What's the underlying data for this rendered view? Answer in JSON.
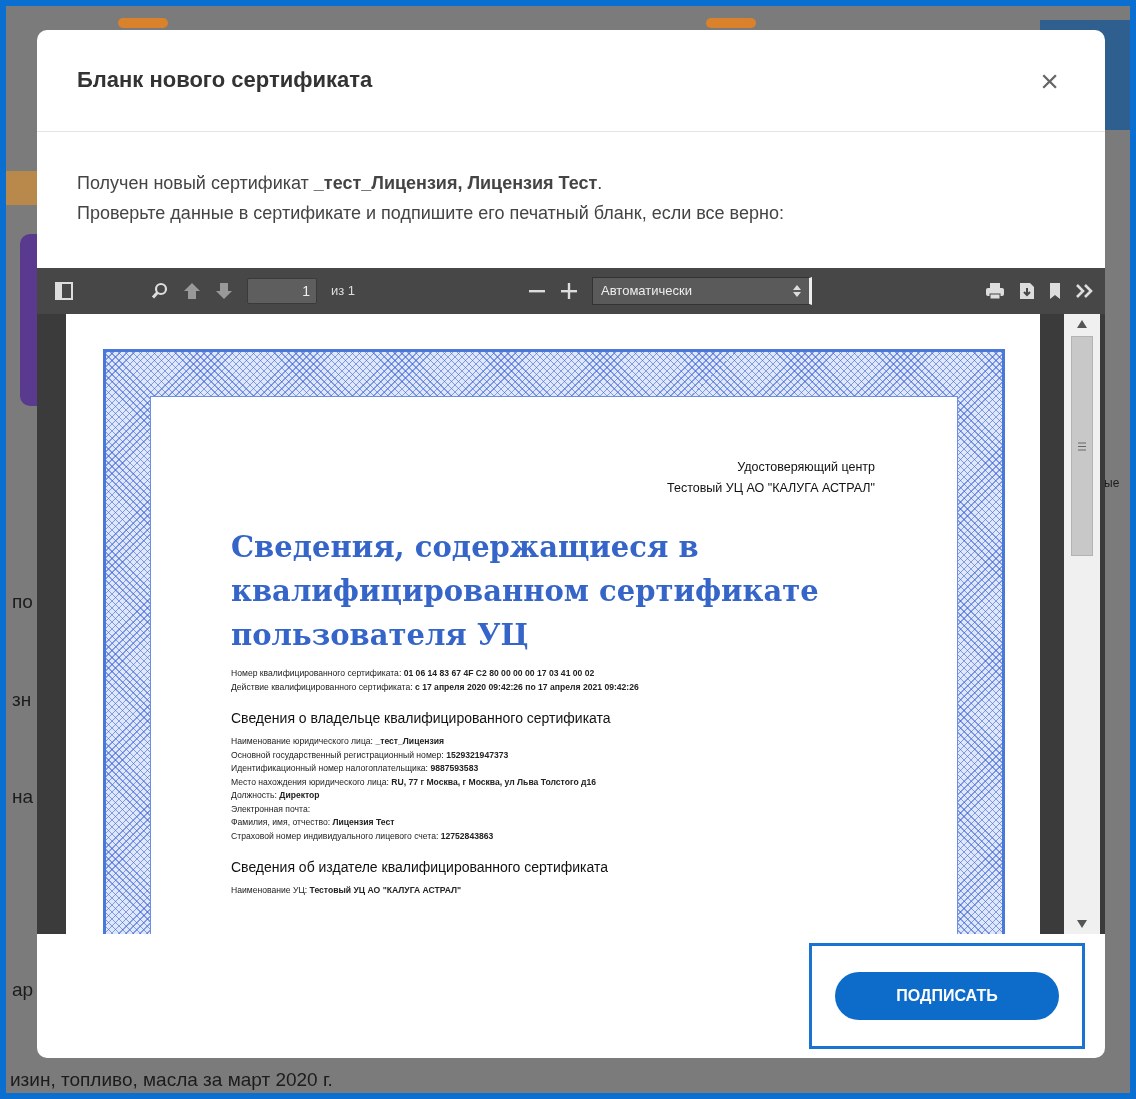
{
  "background": {
    "left_fragments": [
      "по",
      "зн",
      "на",
      "ар"
    ],
    "right_fragment": "ые",
    "bottom_text": "изин, топливо, масла за март 2020 г."
  },
  "dialog": {
    "title": "Бланк нового сертификата",
    "close": "×",
    "message": [
      "Получен новый сертификат **_тест_Лицензия, Лицензия Тест**.",
      "Проверьте данные в сертификате и подпишите его печатный бланк, если все верно:"
    ],
    "viewer": {
      "page_number": "1",
      "page_count": "из 1",
      "zoom": "Автоматически",
      "document": {
        "issuer": [
          "Удостоверяющий центр",
          "Тестовый УЦ АО \"КАЛУГА АСТРАЛ\""
        ],
        "title": "Сведения, содержащиеся в квалифицированном сертификате пользователя УЦ",
        "lines": [
          "Номер квалифицированного сертификата: **01 06 14 83 67 4F C2 80 00 00 00 17 03 41 00 02**",
          "Действие квалифицированного сертификата: **с 17 апреля 2020 09:42:26 по 17 апреля 2021 09:42:26**"
        ],
        "sections": [
          {
            "heading": "Сведения о владельце квалифицированного сертификата",
            "lines": [
              "Наименование юридического лица: **_тест_Лицензия**",
              "Основной государственный регистрационный номер: **1529321947373**",
              "Идентификационный номер налогоплательщика: **9887593583**",
              "Место нахождения юридического лица: **RU, 77 г Москва, г Москва, ул Льва Толстого д16**",
              "Должность: **Директор**",
              "Электронная почта:",
              "Фамилия, имя, отчество: **Лицензия Тест**",
              "Страховой номер индивидуального лицевого счета: **12752843863**"
            ]
          },
          {
            "heading": "Сведения об издателе квалифицированного сертификата",
            "lines": [
              "Наименование УЦ: **Тестовый УЦ АО \"КАЛУГА АСТРАЛ\"**"
            ]
          }
        ]
      }
    },
    "sign_button": "ПОДПИСАТЬ"
  }
}
